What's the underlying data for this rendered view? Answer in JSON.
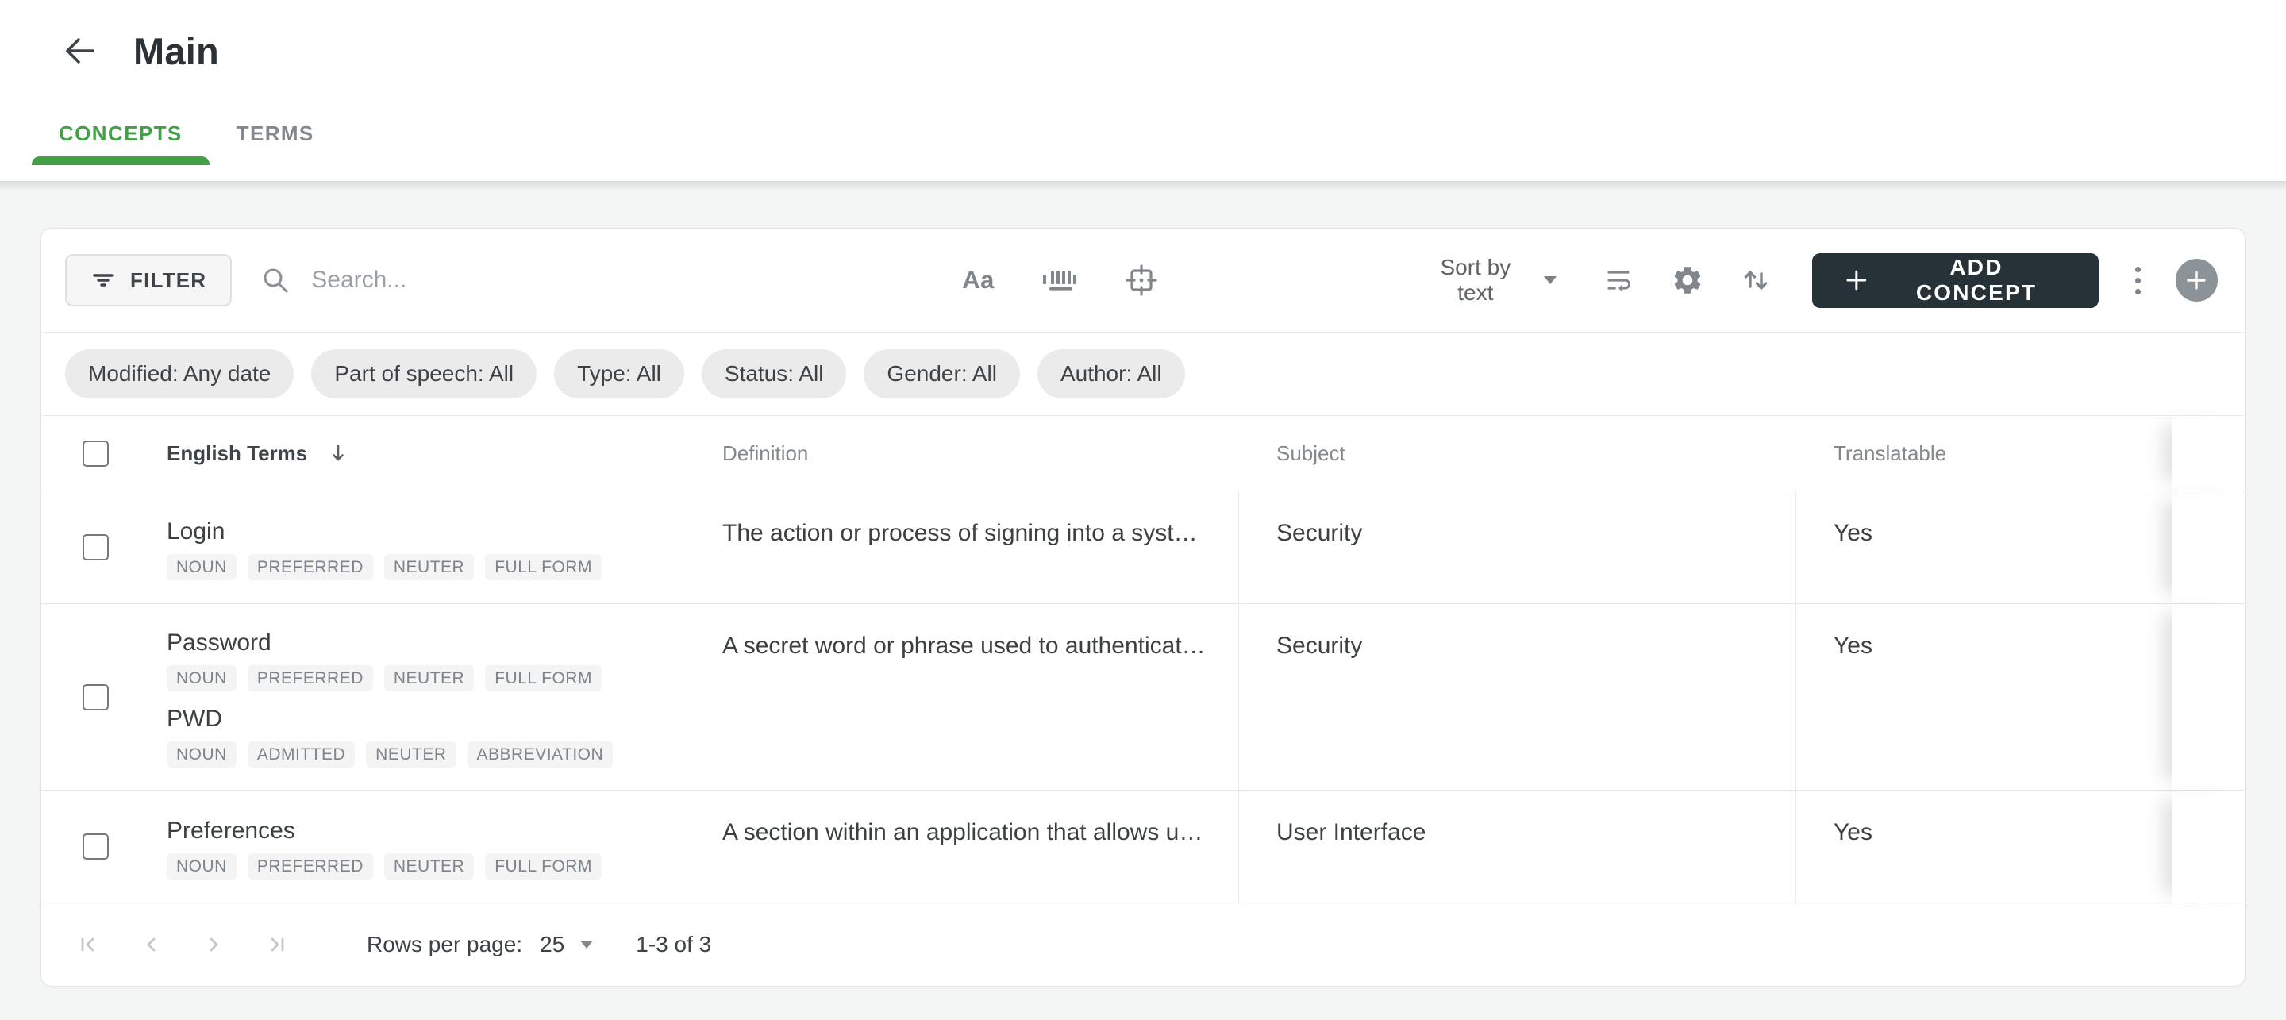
{
  "header": {
    "title": "Main"
  },
  "tabs": [
    {
      "label": "CONCEPTS",
      "active": true
    },
    {
      "label": "TERMS",
      "active": false
    }
  ],
  "toolbar": {
    "filter_label": "FILTER",
    "search_placeholder": "Search...",
    "match_case_label": "Aa",
    "sort_label": "Sort by text",
    "add_concept_label": "ADD CONCEPT"
  },
  "filters": [
    "Modified: Any date",
    "Part of speech: All",
    "Type: All",
    "Status: All",
    "Gender: All",
    "Author: All"
  ],
  "table": {
    "columns": [
      "English Terms",
      "Definition",
      "Subject",
      "Translatable"
    ],
    "sort_column": "English Terms",
    "sort_direction": "desc",
    "rows": [
      {
        "terms": [
          {
            "text": "Login",
            "badges": [
              "NOUN",
              "PREFERRED",
              "NEUTER",
              "FULL FORM"
            ]
          }
        ],
        "definition": "The action or process of signing into a system,…",
        "subject": "Security",
        "translatable": "Yes"
      },
      {
        "terms": [
          {
            "text": "Password",
            "badges": [
              "NOUN",
              "PREFERRED",
              "NEUTER",
              "FULL FORM"
            ]
          },
          {
            "text": "PWD",
            "badges": [
              "NOUN",
              "ADMITTED",
              "NEUTER",
              "ABBREVIATION"
            ]
          }
        ],
        "definition": "A secret word or phrase used to authenticate a…",
        "subject": "Security",
        "translatable": "Yes"
      },
      {
        "terms": [
          {
            "text": "Preferences",
            "badges": [
              "NOUN",
              "PREFERRED",
              "NEUTER",
              "FULL FORM"
            ]
          }
        ],
        "definition": "A section within an application that allows use…",
        "subject": "User Interface",
        "translatable": "Yes"
      }
    ]
  },
  "pagination": {
    "rows_per_page_label": "Rows per page:",
    "rows_per_page_value": "25",
    "range": "1-3 of 3"
  },
  "icons": [
    "back-arrow",
    "filter-list",
    "search",
    "match-case",
    "whole-word",
    "exact-match-target",
    "wrap-text",
    "settings-gear",
    "sort-arrows",
    "plus",
    "kebab-menu",
    "plus-circle",
    "sort-desc-arrow",
    "first-page",
    "prev-page",
    "next-page",
    "last-page",
    "dropdown-caret"
  ],
  "colors": {
    "accent_green": "#43a047",
    "dark_button": "#263238",
    "page_background": "#f4f5f5"
  }
}
